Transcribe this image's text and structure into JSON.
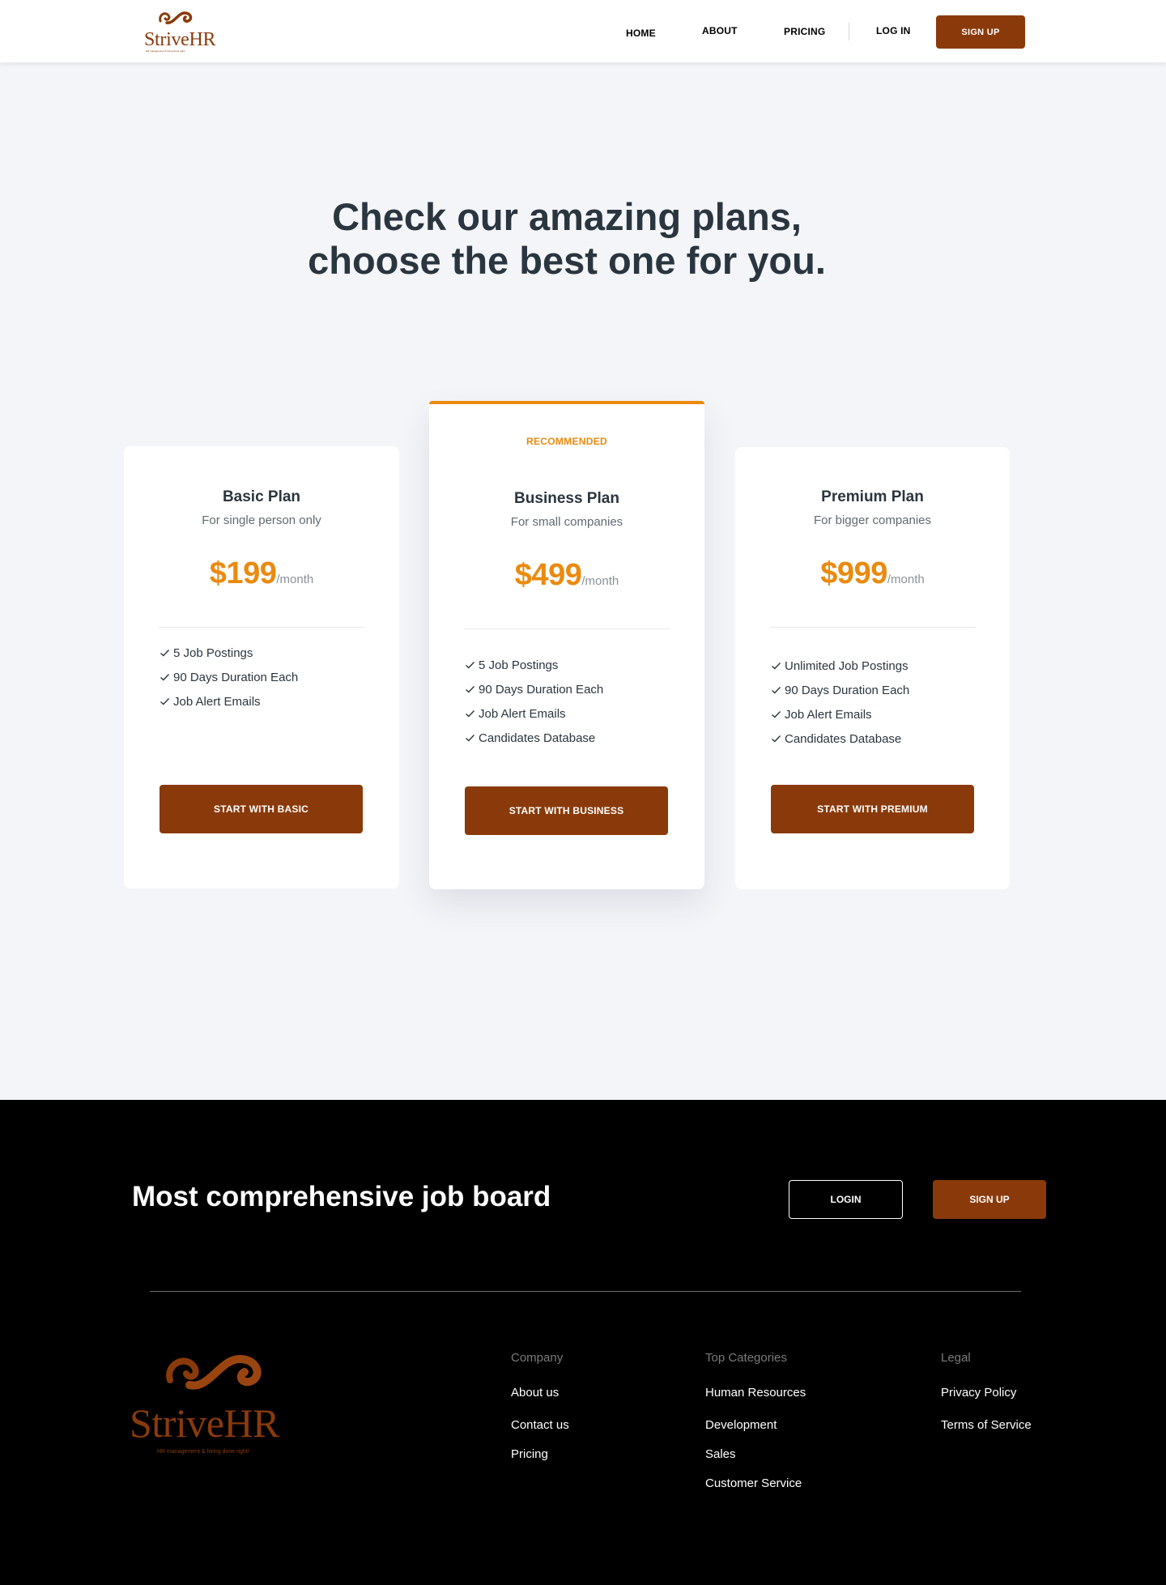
{
  "header": {
    "logo_text": "StriveHR",
    "logo_tagline": "HR management & hiring done right!",
    "nav": {
      "home": "HOME",
      "about": "ABOUT",
      "pricing": "PRICING",
      "login": "LOG IN",
      "signup": "SIGN UP"
    }
  },
  "hero": {
    "title_line1": "Check our amazing plans,",
    "title_line2": "choose the best one for you."
  },
  "plans": [
    {
      "name": "Basic Plan",
      "subtitle": "For single person only",
      "price": "$199",
      "period": "/month",
      "features": [
        "5 Job Postings",
        "90 Days Duration Each",
        "Job Alert Emails"
      ],
      "cta": "START WITH BASIC"
    },
    {
      "badge": "RECOMMENDED",
      "name": "Business Plan",
      "subtitle": "For small companies",
      "price": "$499",
      "period": "/month",
      "features": [
        "5 Job Postings",
        "90 Days Duration Each",
        "Job Alert Emails",
        "Candidates Database"
      ],
      "cta": "START WITH BUSINESS"
    },
    {
      "name": "Premium Plan",
      "subtitle": "For bigger companies",
      "price": "$999",
      "period": "/month",
      "features": [
        "Unlimited Job Postings",
        "90 Days Duration Each",
        "Job Alert Emails",
        "Candidates Database"
      ],
      "cta": "START WITH PREMIUM"
    }
  ],
  "footer": {
    "title": "Most comprehensive job board",
    "login": "LOGIN",
    "signup": "SIGN UP",
    "logo_text": "StriveHR",
    "logo_tagline": "HR management & hiring done right!",
    "columns": [
      {
        "heading": "Company",
        "links": [
          "About us",
          "Contact us",
          "Pricing"
        ]
      },
      {
        "heading": "Top Categories",
        "links": [
          "Human Resources",
          "Development",
          "Sales",
          "Customer Service"
        ]
      },
      {
        "heading": "Legal",
        "links": [
          "Privacy Policy",
          "Terms of Service"
        ]
      }
    ]
  },
  "colors": {
    "brand": "#8a3a0a",
    "accent": "#ea8a0f",
    "text_dark": "#2a363f",
    "page_bg": "#f4f5f9",
    "footer_bg": "#000000"
  }
}
